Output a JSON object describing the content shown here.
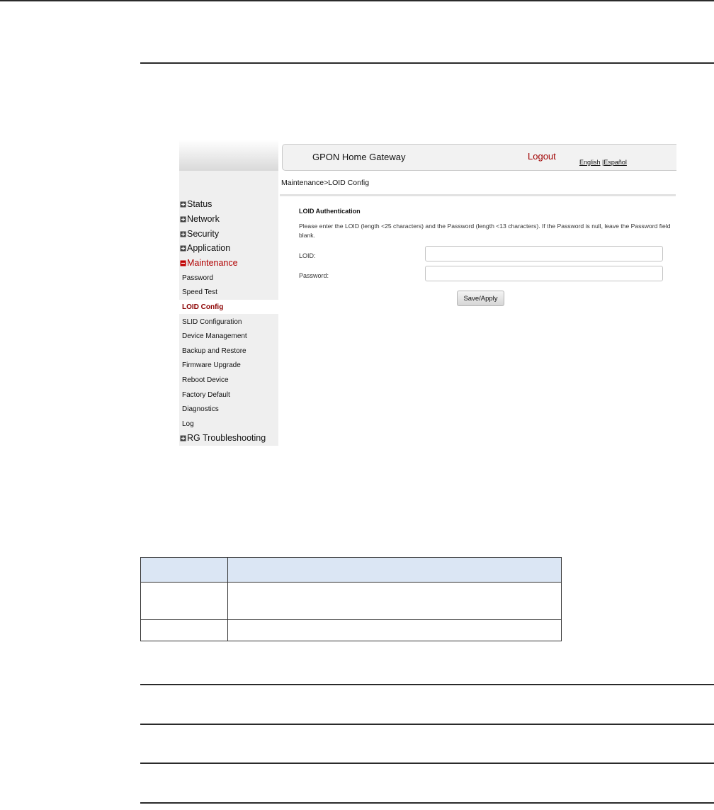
{
  "app": {
    "title": "GPON Home Gateway",
    "logout": "Logout",
    "lang_english": "English",
    "lang_sep": " |",
    "lang_espanol": "Español"
  },
  "sidebar": {
    "menus": [
      {
        "label": "Status",
        "icon": "plus-square-icon"
      },
      {
        "label": "Network",
        "icon": "plus-square-icon"
      },
      {
        "label": "Security",
        "icon": "plus-square-icon"
      },
      {
        "label": "Application",
        "icon": "plus-square-icon"
      },
      {
        "label": "Maintenance",
        "icon": "minus-square-icon",
        "active": true
      }
    ],
    "sub_items": [
      "Password",
      "Speed Test",
      "LOID Config",
      "SLID Configuration",
      "Device Management",
      "Backup and Restore",
      "Firmware Upgrade",
      "Reboot Device",
      "Factory Default",
      "Diagnostics",
      "Log"
    ],
    "selected_sub_item": "LOID Config",
    "last_menu": {
      "label": "RG Troubleshooting",
      "icon": "plus-square-icon"
    }
  },
  "breadcrumb": "Maintenance>LOID Config",
  "form": {
    "section_title": "LOID Authentication",
    "description": "Please enter the LOID (length <25 characters) and the Password (length <13 characters). If the Password is null, leave the Password field blank.",
    "loid_label": "LOID:",
    "loid_value": "",
    "password_label": "Password:",
    "password_value": "",
    "save_label": "Save/Apply"
  },
  "param_table": {
    "headers": [
      "",
      ""
    ],
    "rows": [
      [
        "",
        ""
      ],
      [
        "",
        ""
      ]
    ]
  },
  "colors": {
    "active_menu": "#b10000",
    "selected_sub_item": "#8b0000",
    "logout": "#a00000",
    "table_header_bg": "#dbe6f4"
  }
}
